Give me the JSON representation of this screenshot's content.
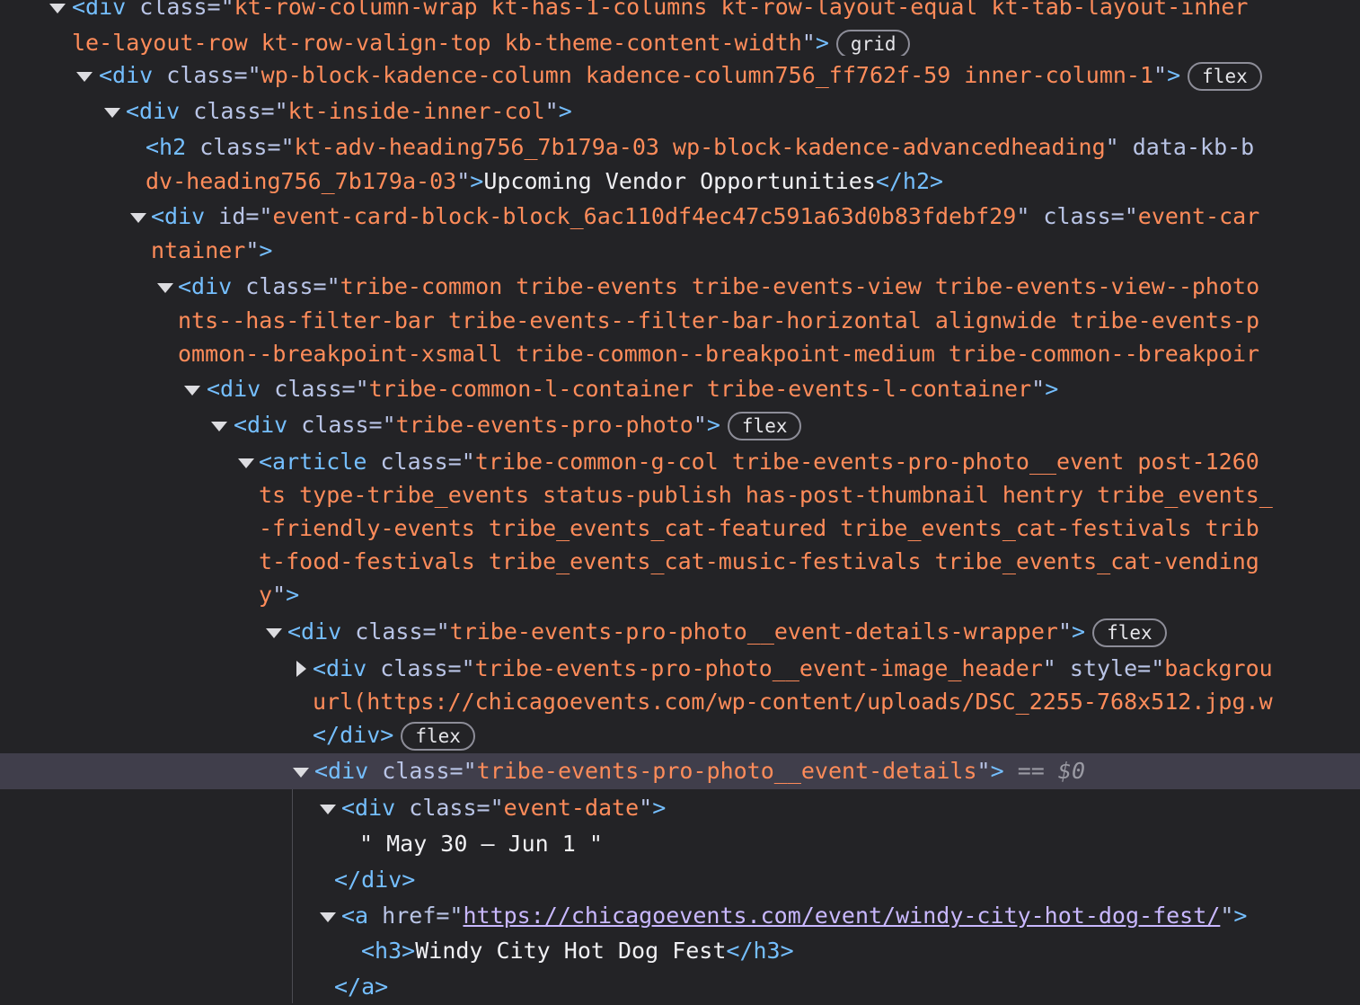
{
  "lines": [
    {
      "id": "r1",
      "name": "node-row-kt-row-column-wrap",
      "tri": "open",
      "badge": "",
      "text": [
        [
          {
            "c": "tag",
            "t": "<div"
          },
          {
            "c": "attr",
            "t": " class=\""
          },
          {
            "c": "val",
            "t": "kt-row-column-wrap kt-has-1-columns kt-row-layout-equal kt-tab-layout-inher"
          }
        ],
        [
          {
            "c": "val",
            "t": "le-layout-row kt-row-valign-top kb-theme-content-width"
          },
          {
            "c": "attr",
            "t": "\""
          },
          {
            "c": "tag",
            "t": ">"
          }
        ]
      ],
      "badge_line": 1,
      "badge_text": "grid"
    },
    {
      "id": "r2",
      "name": "node-row-kadence-column",
      "tri": "open",
      "text": [
        [
          {
            "c": "tag",
            "t": "<div"
          },
          {
            "c": "attr",
            "t": " class=\""
          },
          {
            "c": "val",
            "t": "wp-block-kadence-column kadence-column756_ff762f-59 inner-column-1"
          },
          {
            "c": "attr",
            "t": "\""
          },
          {
            "c": "tag",
            "t": ">"
          }
        ]
      ],
      "badge_line": 0,
      "badge_text": "flex"
    },
    {
      "id": "r3",
      "name": "node-row-kt-inside-inner-col",
      "tri": "open",
      "text": [
        [
          {
            "c": "tag",
            "t": "<div"
          },
          {
            "c": "attr",
            "t": " class=\""
          },
          {
            "c": "val",
            "t": "kt-inside-inner-col"
          },
          {
            "c": "attr",
            "t": "\""
          },
          {
            "c": "tag",
            "t": ">"
          }
        ]
      ]
    },
    {
      "id": "r4",
      "name": "node-row-h2-heading",
      "tri": "",
      "text": [
        [
          {
            "c": "tag",
            "t": "<h2"
          },
          {
            "c": "attr",
            "t": " class=\""
          },
          {
            "c": "val",
            "t": "kt-adv-heading756_7b179a-03 wp-block-kadence-advancedheading"
          },
          {
            "c": "attr",
            "t": "\" data-kb-b"
          }
        ],
        [
          {
            "c": "val",
            "t": "dv-heading756_7b179a-03"
          },
          {
            "c": "attr",
            "t": "\""
          },
          {
            "c": "tag",
            "t": ">"
          },
          {
            "c": "txt",
            "t": "Upcoming Vendor Opportunities"
          },
          {
            "c": "tag",
            "t": "</h2>"
          }
        ]
      ]
    },
    {
      "id": "r5",
      "name": "node-row-event-card-block",
      "tri": "open",
      "text": [
        [
          {
            "c": "tag",
            "t": "<div"
          },
          {
            "c": "attr",
            "t": " id=\""
          },
          {
            "c": "val",
            "t": "event-card-block-block_6ac110df4ec47c591a63d0b83fdebf29"
          },
          {
            "c": "attr",
            "t": "\" class=\""
          },
          {
            "c": "val",
            "t": "event-car"
          }
        ],
        [
          {
            "c": "val",
            "t": "ntainer"
          },
          {
            "c": "attr",
            "t": "\""
          },
          {
            "c": "tag",
            "t": ">"
          }
        ]
      ]
    },
    {
      "id": "r6",
      "name": "node-row-tribe-common",
      "tri": "open",
      "text": [
        [
          {
            "c": "tag",
            "t": "<div"
          },
          {
            "c": "attr",
            "t": " class=\""
          },
          {
            "c": "val",
            "t": "tribe-common tribe-events tribe-events-view tribe-events-view--photo"
          }
        ],
        [
          {
            "c": "val",
            "t": "nts--has-filter-bar tribe-events--filter-bar-horizontal alignwide tribe-events-p"
          }
        ],
        [
          {
            "c": "val",
            "t": "ommon--breakpoint-xsmall tribe-common--breakpoint-medium tribe-common--breakpoir"
          }
        ]
      ]
    },
    {
      "id": "r7",
      "name": "node-row-tribe-common-l-container",
      "tri": "open",
      "text": [
        [
          {
            "c": "tag",
            "t": "<div"
          },
          {
            "c": "attr",
            "t": " class=\""
          },
          {
            "c": "val",
            "t": "tribe-common-l-container tribe-events-l-container"
          },
          {
            "c": "attr",
            "t": "\""
          },
          {
            "c": "tag",
            "t": ">"
          }
        ]
      ]
    },
    {
      "id": "r8",
      "name": "node-row-tribe-events-pro-photo",
      "tri": "open",
      "text": [
        [
          {
            "c": "tag",
            "t": "<div"
          },
          {
            "c": "attr",
            "t": " class=\""
          },
          {
            "c": "val",
            "t": "tribe-events-pro-photo"
          },
          {
            "c": "attr",
            "t": "\""
          },
          {
            "c": "tag",
            "t": ">"
          }
        ]
      ],
      "badge_line": 0,
      "badge_text": "flex"
    },
    {
      "id": "r9",
      "name": "node-row-article",
      "tri": "open",
      "text": [
        [
          {
            "c": "tag",
            "t": "<article"
          },
          {
            "c": "attr",
            "t": " class=\""
          },
          {
            "c": "val",
            "t": "tribe-common-g-col tribe-events-pro-photo__event post-1260"
          }
        ],
        [
          {
            "c": "val",
            "t": "ts type-tribe_events status-publish has-post-thumbnail hentry tribe_events_"
          }
        ],
        [
          {
            "c": "val",
            "t": "-friendly-events tribe_events_cat-featured tribe_events_cat-festivals trib"
          }
        ],
        [
          {
            "c": "val",
            "t": "t-food-festivals tribe_events_cat-music-festivals tribe_events_cat-vending"
          }
        ],
        [
          {
            "c": "val",
            "t": "y"
          },
          {
            "c": "attr",
            "t": "\""
          },
          {
            "c": "tag",
            "t": ">"
          }
        ]
      ]
    },
    {
      "id": "r10",
      "name": "node-row-event-details-wrapper",
      "tri": "open",
      "text": [
        [
          {
            "c": "tag",
            "t": "<div"
          },
          {
            "c": "attr",
            "t": " class=\""
          },
          {
            "c": "val",
            "t": "tribe-events-pro-photo__event-details-wrapper"
          },
          {
            "c": "attr",
            "t": "\""
          },
          {
            "c": "tag",
            "t": ">"
          }
        ]
      ],
      "badge_line": 0,
      "badge_text": "flex"
    },
    {
      "id": "r11",
      "name": "node-row-event-image-header",
      "tri": "closed",
      "text": [
        [
          {
            "c": "tag",
            "t": "<div"
          },
          {
            "c": "attr",
            "t": " class=\""
          },
          {
            "c": "val",
            "t": "tribe-events-pro-photo__event-image_header"
          },
          {
            "c": "attr",
            "t": "\" style=\""
          },
          {
            "c": "val",
            "t": "backgrou"
          }
        ],
        [
          {
            "c": "val",
            "t": "url(https://chicagoevents.com/wp-content/uploads/DSC_2255-768x512.jpg.w"
          }
        ],
        [
          {
            "c": "tag",
            "t": "</div>"
          }
        ]
      ],
      "badge_line": 2,
      "badge_text": "flex"
    },
    {
      "id": "r12",
      "name": "node-row-event-details-selected",
      "tri": "open",
      "selected": true,
      "text": [
        [
          {
            "c": "tag",
            "t": "<div"
          },
          {
            "c": "attr",
            "t": " class=\""
          },
          {
            "c": "val",
            "t": "tribe-events-pro-photo__event-details"
          },
          {
            "c": "attr",
            "t": "\""
          },
          {
            "c": "tag",
            "t": ">"
          },
          {
            "c": "eq",
            "t": " == "
          },
          {
            "c": "ref",
            "t": "$0"
          }
        ]
      ]
    },
    {
      "id": "r13",
      "name": "node-row-event-date",
      "tri": "open",
      "text": [
        [
          {
            "c": "tag",
            "t": "<div"
          },
          {
            "c": "attr",
            "t": " class=\""
          },
          {
            "c": "val",
            "t": "event-date"
          },
          {
            "c": "attr",
            "t": "\""
          },
          {
            "c": "tag",
            "t": ">"
          }
        ]
      ]
    },
    {
      "id": "r14",
      "name": "node-row-event-date-text",
      "tri": "",
      "text": [
        [
          {
            "c": "txt",
            "t": "\" May 30 – Jun 1 \""
          }
        ]
      ]
    },
    {
      "id": "r15",
      "name": "node-row-div-close",
      "tri": "",
      "text": [
        [
          {
            "c": "tag",
            "t": "</div>"
          }
        ]
      ]
    },
    {
      "id": "r16",
      "name": "node-row-anchor",
      "tri": "open",
      "text": [
        [
          {
            "c": "tag",
            "t": "<a"
          },
          {
            "c": "attr",
            "t": " href=\""
          },
          {
            "c": "link",
            "t": "https://chicagoevents.com/event/windy-city-hot-dog-fest/"
          },
          {
            "c": "attr",
            "t": "\""
          },
          {
            "c": "tag",
            "t": ">"
          }
        ]
      ]
    },
    {
      "id": "r17",
      "name": "node-row-h3",
      "tri": "",
      "text": [
        [
          {
            "c": "tag",
            "t": "<h3>"
          },
          {
            "c": "txt",
            "t": "Windy City Hot Dog Fest"
          },
          {
            "c": "tag",
            "t": "</h3>"
          }
        ]
      ]
    },
    {
      "id": "r18",
      "name": "node-row-anchor-close",
      "tri": "",
      "text": [
        [
          {
            "c": "tag",
            "t": "</a>"
          }
        ]
      ]
    }
  ]
}
